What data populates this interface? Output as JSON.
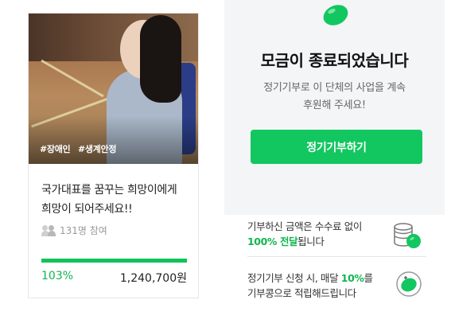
{
  "campaign": {
    "tags": [
      "#장애인",
      "#생계안정"
    ],
    "title_line1": "국가대표를 꿈꾸는 희망이에게",
    "title_line2": "희망이 되어주세요!!",
    "participants": "131명 참여",
    "progress_percent": 103,
    "percent_label": "103%",
    "amount": "1,240,700원"
  },
  "panel": {
    "ended_title": "모금이 종료되었습니다",
    "desc_line1": "정기기부로 이 단체의 사업을 계속",
    "desc_line2": "후원해 주세요!",
    "button_label": "정기기부하기",
    "benefit1_line1": "기부하신 금액은 수수료 없이",
    "benefit1_highlight": "100% 전달",
    "benefit1_suffix": "됩니다",
    "benefit2_prefix": "정기기부 신청 시, 매달 ",
    "benefit2_highlight": "10%",
    "benefit2_suffix": "를",
    "benefit2_line2": "기부콩으로 적립해드립니다"
  },
  "icons": {
    "bean": "green-bean-icon",
    "coins": "coin-stack-icon",
    "participants": "people-icon",
    "benefit_bean": "bean-plus-icon"
  },
  "colors": {
    "accent": "#12c760",
    "accent_text": "#11b54f"
  }
}
